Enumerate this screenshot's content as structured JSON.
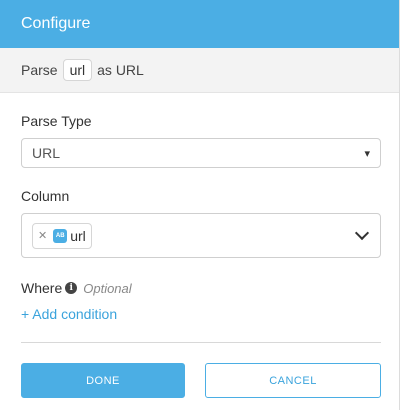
{
  "header": {
    "title": "Configure"
  },
  "summary": {
    "prefix": "Parse",
    "column_chip": "url",
    "suffix": "as URL"
  },
  "parse_type": {
    "label": "Parse Type",
    "selected": "URL"
  },
  "column": {
    "label": "Column",
    "tag_type": "AB",
    "tag_label": "url"
  },
  "where": {
    "label": "Where",
    "optional_text": "Optional",
    "add_condition": "+ Add condition"
  },
  "actions": {
    "done_label": "DONE",
    "cancel_label": "CANCEL"
  },
  "colors": {
    "accent": "#4baee4",
    "link": "#3aa3dc"
  }
}
